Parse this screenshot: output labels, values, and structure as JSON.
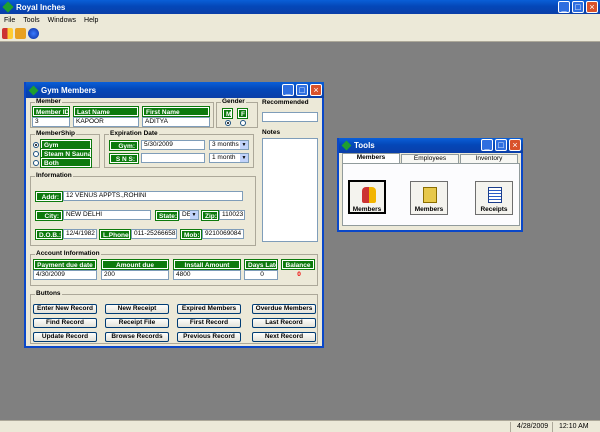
{
  "app": {
    "title": "Royal Inches",
    "menu": [
      "File",
      "Tools",
      "Windows",
      "Help"
    ]
  },
  "status": {
    "date": "4/28/2009",
    "time": "12:10 AM"
  },
  "gym": {
    "title": "Gym Members",
    "member_group": "Member",
    "member_id_label": "Member ID",
    "member_id": "3",
    "last_name_label": "Last Name",
    "last_name": "KAPOOR",
    "first_name_label": "First Name",
    "first_name": "ADITYA",
    "gender_label": "Gender",
    "gender_m": "M",
    "gender_f": "F",
    "recommended_label": "Recommended",
    "recommended": "",
    "membership_label": "MemberShip",
    "membership_options": [
      "Gym",
      "Steam N Sauna",
      "Both"
    ],
    "expiration_label": "Expiration Date",
    "gym_label": "Gym:",
    "gym_date": "5/30/2009",
    "gym_period": "3 months",
    "sns_label": "S N S:",
    "sns_date": "",
    "sns_period": "1 month",
    "notes_label": "Notes",
    "notes": "",
    "info_label": "Information",
    "addr_label": "Addr:",
    "addr": "12 VENUS APPTS.,ROHINI",
    "city_label": "City:",
    "city": "NEW DELHI",
    "state_label": "State:",
    "state": "DE",
    "zip_label": "Zip:",
    "zip": "110023",
    "dob_label": "D.O.B.:",
    "dob": "12/4/1982",
    "lphone_label": "L.Phone:",
    "lphone": "011-25266658",
    "mob_label": "Mob:",
    "mob": "9210069084",
    "account_label": "Account Information",
    "payment_due_label": "Payment due date",
    "payment_due": "4/30/2009",
    "amount_due_label": "Amount due",
    "amount_due": "200",
    "install_label": "Install Amount",
    "install": "4800",
    "days_late_label": "Days Late",
    "days_late": "0",
    "balance_label": "Balance",
    "balance": "0",
    "buttons_label": "Buttons",
    "buttons": [
      "Enter New Record",
      "New Receipt",
      "Expired Members",
      "Overdue Members",
      "Find Record",
      "Receipt File",
      "First Record",
      "Last Record",
      "Update Record",
      "Browse Records",
      "Previous Record",
      "Next Record"
    ]
  },
  "tools": {
    "title": "Tools",
    "tabs": [
      "Members",
      "Employees",
      "Inventory"
    ],
    "items": [
      "Members",
      "Members",
      "Receipts"
    ]
  },
  "colors": {
    "title_blue": "#0447b8",
    "label_green": "#0d7a0d",
    "window_bg": "#ece9d8",
    "desktop": "#808080"
  }
}
